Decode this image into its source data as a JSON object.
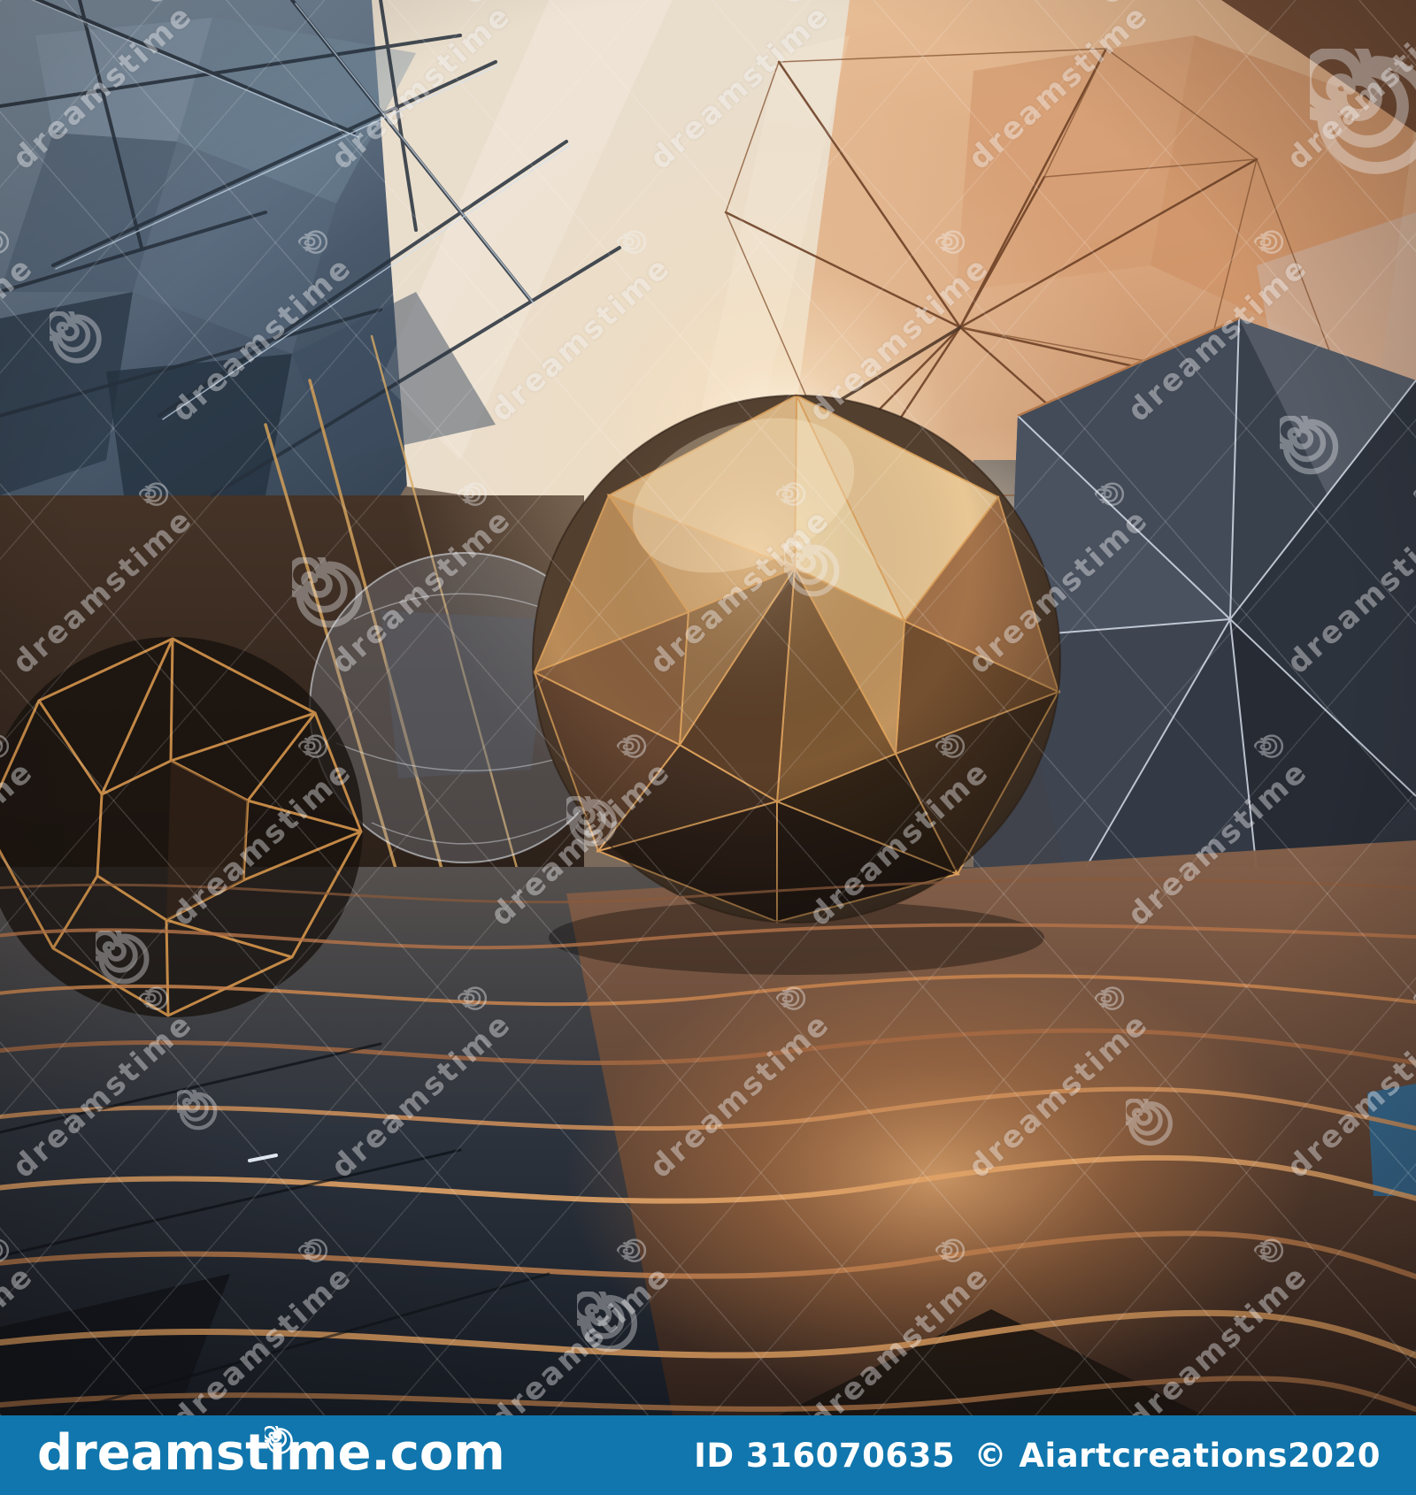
{
  "page": {
    "type": "stock-photo-preview"
  },
  "watermark": {
    "text": "dreamstime",
    "spiral_icon": "spiral-icon",
    "tile_color": "#f4f4f6"
  },
  "footer": {
    "logo": "dreamstime.com",
    "image_id": "ID 316070635",
    "credit": "© Aiartcreations2020",
    "bar_color": "#1076ad",
    "text_color": "#ffffff"
  },
  "palette": {
    "sky_glass_blue": "#6d8093",
    "glass_dark": "#2c3a49",
    "bright_glow": "#f7efe3",
    "canopy_peach": "#dfae84",
    "sphere_gold": "#d9a26a",
    "sphere_dark": "#3a2b21",
    "wire_gold": "#c98d4d",
    "floor_slate": "#2a303b",
    "floor_brown": "#7a5139",
    "crack_gold": "#d89a5e",
    "blue_patch": "#2e6f9e"
  }
}
